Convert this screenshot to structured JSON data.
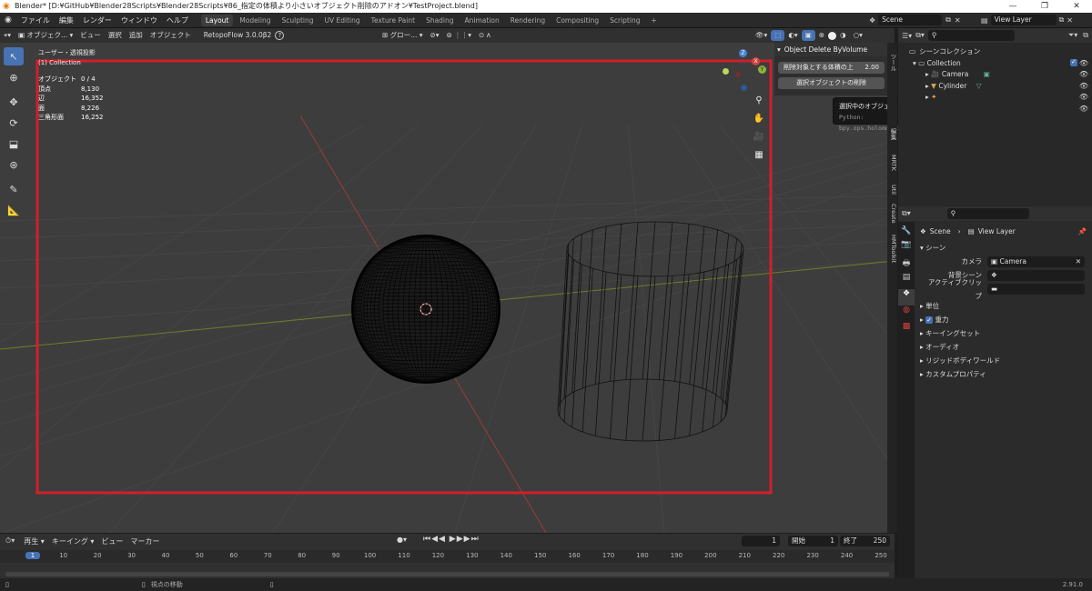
{
  "window": {
    "title": "Blender* [D:¥GitHub¥Blender28Scripts¥Blender28Scripts¥86_指定の体積より小さいオブジェクト削除のアドオン¥TestProject.blend]",
    "min": "—",
    "max": "❐",
    "close": "✕"
  },
  "menubar": {
    "menus": [
      "ファイル",
      "編集",
      "レンダー",
      "ウィンドウ",
      "ヘルプ"
    ],
    "workspaces": [
      "Layout",
      "Modeling",
      "Sculpting",
      "UV Editing",
      "Texture Paint",
      "Shading",
      "Animation",
      "Rendering",
      "Compositing",
      "Scripting"
    ],
    "add_tab": "+",
    "scene": "Scene",
    "view_layer": "View Layer"
  },
  "viewport_header": {
    "mode": "オブジェク...",
    "menus": [
      "ビュー",
      "選択",
      "追加",
      "オブジェクト"
    ],
    "addon": "RetopoFlow 3.0.0β2",
    "help": "?",
    "orientation": "グロー..."
  },
  "viewport": {
    "view_name": "ユーザー・透視投影",
    "collection": "(1) Collection",
    "stats": [
      {
        "label": "オブジェクト",
        "value": "0 / 4"
      },
      {
        "label": "頂点",
        "value": "8,130"
      },
      {
        "label": "辺",
        "value": "16,352"
      },
      {
        "label": "面",
        "value": "8,226"
      },
      {
        "label": "三角形面",
        "value": "16,252"
      }
    ],
    "gizmo": {
      "z": "Z",
      "y": "Y",
      "x": "X"
    }
  },
  "npanel": {
    "title": "Object Delete ByVolume",
    "volume_label": "削除対象とする体積の上",
    "volume_value": "2.00",
    "delete_button": "選択オブジェクトの削除"
  },
  "tooltip": {
    "text": "選択中のオブジェクトを全て削除します。",
    "python": "Python: bpy.ops.holomon.decimate_object()"
  },
  "sidebar_tabs": [
    "ツール",
    "編集",
    "MRTK",
    "Util",
    "Create",
    "HMToolkit"
  ],
  "outliner": {
    "root": "シーンコレクション",
    "collection": "Collection",
    "items": [
      "Camera",
      "Cylinder"
    ]
  },
  "properties": {
    "scene_breadcrumb": "Scene",
    "view_layer_breadcrumb": "View Layer",
    "scene_panel": "シーン",
    "camera_label": "カメラ",
    "camera_value": "Camera",
    "background_label": "背景シーン",
    "clip_label": "アクティブクリップ",
    "panels": [
      "単位",
      "重力",
      "キーイングセット",
      "オーディオ",
      "リジッドボディワールド",
      "カスタムプロパティ"
    ]
  },
  "timeline": {
    "menus": [
      "再生",
      "キーイング",
      "ビュー",
      "マーカー"
    ],
    "current_frame": "1",
    "start_label": "開始",
    "start": "1",
    "end_label": "終了",
    "end": "250",
    "ticks": [
      "1",
      "10",
      "20",
      "30",
      "40",
      "50",
      "60",
      "70",
      "80",
      "90",
      "100",
      "110",
      "120",
      "130",
      "140",
      "150",
      "160",
      "170",
      "180",
      "190",
      "200",
      "210",
      "220",
      "230",
      "240",
      "250"
    ]
  },
  "statusbar": {
    "hint": "視点の移動",
    "version": "2.91.0"
  },
  "colors": {
    "accent": "#4772b3",
    "highlight_box": "#d0202a",
    "x_axis": "#d0423f",
    "y_axis": "#8db33a"
  }
}
